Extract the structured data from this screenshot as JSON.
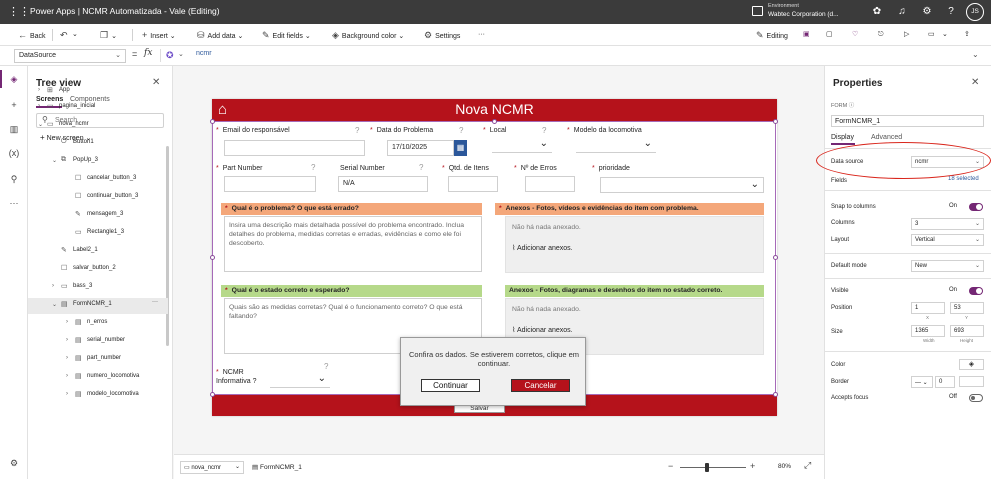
{
  "titlebar": {
    "app_title": "Power Apps  |  NCMR Automatizada - Vale (Editing)",
    "env_label": "Environment",
    "env_name": "Wabtec Corporation (d...",
    "avatar": "JS"
  },
  "toolbar": {
    "back": "Back",
    "insert": "Insert",
    "add_data": "Add data",
    "edit_fields": "Edit fields",
    "background_color": "Background color",
    "settings": "Settings",
    "more": "···",
    "editing": "Editing"
  },
  "formula": {
    "property": "DataSource",
    "equals": "=",
    "fx": "fx",
    "value": "ncmr"
  },
  "tree": {
    "title": "Tree view",
    "tab_screens": "Screens",
    "tab_components": "Components",
    "search_placeholder": "Search",
    "new_screen": "New screen",
    "items": [
      {
        "label": "App"
      },
      {
        "label": "pagina_inicial"
      },
      {
        "label": "nova_ncmr"
      },
      {
        "label": "Button1"
      },
      {
        "label": "PopUp_3"
      },
      {
        "label": "cancelar_button_3"
      },
      {
        "label": "continuar_button_3"
      },
      {
        "label": "mensagem_3"
      },
      {
        "label": "Rectangle1_3"
      },
      {
        "label": "Label2_1"
      },
      {
        "label": "salvar_button_2"
      },
      {
        "label": "bass_3"
      },
      {
        "label": "FormNCMR_1"
      },
      {
        "label": "n_erros"
      },
      {
        "label": "serial_number"
      },
      {
        "label": "part_number"
      },
      {
        "label": "numero_locomotiva"
      },
      {
        "label": "modelo_locomotiva"
      }
    ]
  },
  "form": {
    "title": "Nova NCMR",
    "email_label": "Email do responsável",
    "date_label": "Data do Problema",
    "date_value": "17/10/2025",
    "local_label": "Local",
    "modelo_label": "Modelo da locomotiva",
    "part_label": "Part Number",
    "serial_label": "Serial Number",
    "serial_value": "N/A",
    "qtd_label": "Qtd. de Itens",
    "erros_label": "Nº de Erros",
    "prioridade_label": "prioridade",
    "problema_label": "Qual é o problema? O que está errado?",
    "problema_placeholder": "Insira uma descrição mais detalhada possível do problema encontrado. Inclua detalhes do problema, medidas corretas e erradas, evidências e como ele foi descoberto.",
    "anexos1_label": "Anexos - Fotos, vídeos e evidências do item com problema.",
    "no_attach": "Não há nada anexado.",
    "add_attach": "Adicionar anexos.",
    "correto_label": "Qual é o estado correto e esperado?",
    "correto_placeholder": "Quais são as medidas corretas? Qual é o funcionamento correto? O que está faltando?",
    "anexos2_label": "Anexos - Fotos, diagramas e desenhos do item no estado correto.",
    "ncmr_label": "NCMR Informativa ?",
    "salvar": "Salvar",
    "colors": {
      "header": "#b5121b",
      "section_orange": "#f4a77a",
      "section_green": "#b6d98a"
    }
  },
  "dialog": {
    "message": "Confira os dados. Se estiverem corretos, clique em continuar.",
    "continue": "Continuar",
    "cancel": "Cancelar"
  },
  "status": {
    "screen": "nova_ncmr",
    "crumb": "FormNCMR_1",
    "zoom": "80",
    "zoom_unit": "%"
  },
  "props": {
    "title": "Properties",
    "type": "FORM",
    "control_name": "FormNCMR_1",
    "tab_display": "Display",
    "tab_advanced": "Advanced",
    "data_source_label": "Data source",
    "data_source_value": "ncmr",
    "fields_label": "Fields",
    "fields_value": "18 selected",
    "snap_label": "Snap to columns",
    "snap_value": "On",
    "columns_label": "Columns",
    "columns_value": "3",
    "layout_label": "Layout",
    "layout_value": "Vertical",
    "default_mode_label": "Default mode",
    "default_mode_value": "New",
    "visible_label": "Visible",
    "visible_value": "On",
    "position_label": "Position",
    "pos_x": "1",
    "pos_y": "53",
    "x_label": "X",
    "y_label": "Y",
    "size_label": "Size",
    "width": "1365",
    "height": "693",
    "width_label": "Width",
    "height_label": "Height",
    "color_label": "Color",
    "border_label": "Border",
    "border_value": "0",
    "accepts_focus_label": "Accepts focus",
    "accepts_focus_value": "Off"
  }
}
